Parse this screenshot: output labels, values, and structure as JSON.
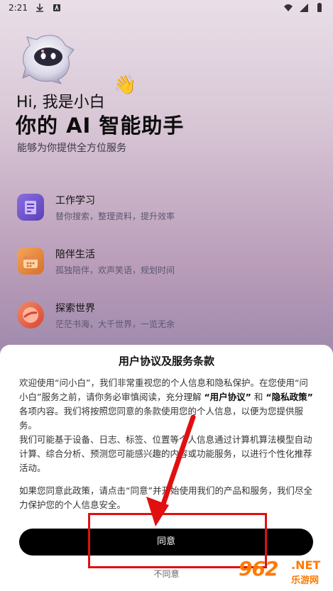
{
  "status_bar": {
    "time": "2:21"
  },
  "hero": {
    "greeting": "Hi, 我是小白",
    "headline": "你的 AI 智能助手",
    "subline": "能够为你提供全方位服务"
  },
  "features": [
    {
      "title": "工作学习",
      "desc": "替你搜索，整理资料，提升效率",
      "icon": "document-icon",
      "color": "#6a4fc8"
    },
    {
      "title": "陪伴生活",
      "desc": "孤独陪伴，欢声笑语，规划时间",
      "icon": "calendar-icon",
      "color": "#e38a3c"
    },
    {
      "title": "探索世界",
      "desc": "茫茫书海，大千世界，一览无余",
      "icon": "planet-icon",
      "color": "#e0553a"
    }
  ],
  "dialog": {
    "title": "用户协议及服务条款",
    "p1_a": "欢迎使用“问小白”，我们非常重视您的个人信息和隐私保护。在您使用“问小白”服务之前，请你务必审慎阅读，充分理解",
    "p1_link1": "“用户协议”",
    "p1_and": "和",
    "p1_link2": "“隐私政策”",
    "p1_b": "各项内容。我们将按照您同意的条款使用您的个人信息，以便为您提供服务。",
    "p2": "我们可能基于设备、日志、标签、位置等个人信息通过计算机算法模型自动计算、综合分析、预测您可能感兴趣的内容或功能服务，以进行个性化推荐活动。",
    "p3": "如果您同意此政策，请点击“同意”并开始使用我们的产品和服务，我们尽全力保护您的个人信息安全。",
    "agree_label": "同意",
    "disagree_label": "不同意"
  },
  "watermark": {
    "logo": "962",
    "net": ".NET",
    "sub": "乐游网"
  },
  "colors": {
    "annotation": "#e01010",
    "button": "#000000",
    "watermark": "#ff7a00"
  }
}
